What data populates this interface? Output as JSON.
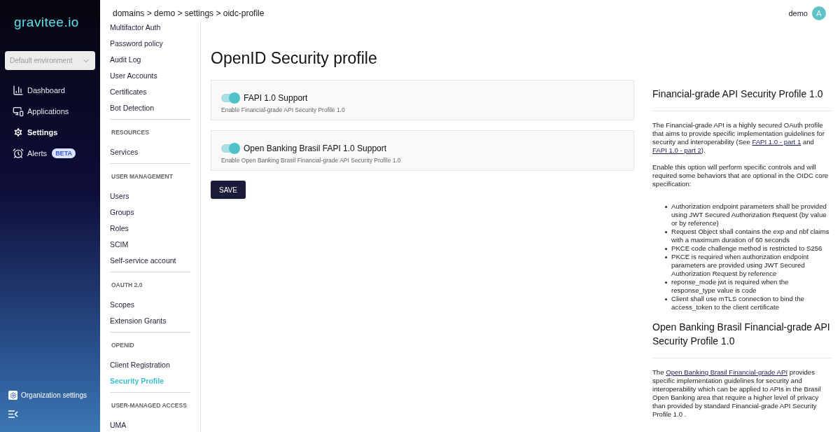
{
  "logo": {
    "text": "gravitee",
    "suffix": ".io"
  },
  "environment": {
    "value": "Default environment"
  },
  "nav": [
    {
      "kind": "chart",
      "label": "Dashboard",
      "selected": false
    },
    {
      "kind": "devices",
      "label": "Applications",
      "selected": false
    },
    {
      "kind": "gear",
      "label": "Settings",
      "selected": true
    },
    {
      "kind": "alarm",
      "label": "Alerts",
      "selected": false,
      "badge": "BETA"
    }
  ],
  "organization_settings": {
    "label": "Organization settings"
  },
  "breadcrumb": "domains > demo > settings > oidc-profile",
  "user": {
    "name": "demo",
    "initial": "A"
  },
  "settings_menu": [
    {
      "kind": "item",
      "label": "Multifactor Auth",
      "selected": false
    },
    {
      "kind": "item",
      "label": "Password policy",
      "selected": false
    },
    {
      "kind": "item",
      "label": "Audit Log",
      "selected": false
    },
    {
      "kind": "item",
      "label": "User Accounts",
      "selected": false
    },
    {
      "kind": "item",
      "label": "Certificates",
      "selected": false
    },
    {
      "kind": "item",
      "label": "Bot Detection",
      "selected": false
    },
    {
      "kind": "section",
      "label": "RESOURCES"
    },
    {
      "kind": "item",
      "label": "Services",
      "selected": false
    },
    {
      "kind": "section",
      "label": "USER MANAGEMENT"
    },
    {
      "kind": "item",
      "label": "Users",
      "selected": false
    },
    {
      "kind": "item",
      "label": "Groups",
      "selected": false
    },
    {
      "kind": "item",
      "label": "Roles",
      "selected": false
    },
    {
      "kind": "item",
      "label": "SCIM",
      "selected": false
    },
    {
      "kind": "item",
      "label": "Self-service account",
      "selected": false
    },
    {
      "kind": "section",
      "label": "OAUTH 2.0"
    },
    {
      "kind": "item",
      "label": "Scopes",
      "selected": false
    },
    {
      "kind": "item",
      "label": "Extension Grants",
      "selected": false
    },
    {
      "kind": "section",
      "label": "OPENID"
    },
    {
      "kind": "item",
      "label": "Client Registration",
      "selected": false
    },
    {
      "kind": "item",
      "label": "Security Profile",
      "selected": true
    },
    {
      "kind": "section",
      "label": "USER-MANAGED ACCESS"
    },
    {
      "kind": "item",
      "label": "UMA",
      "selected": false
    }
  ],
  "page_title": "OpenID Security profile",
  "options": [
    {
      "label": "FAPI 1.0 Support",
      "description": "Enable Financial-grade API Security Profile 1.0",
      "on": true
    },
    {
      "label": "Open Banking Brasil FAPI 1.0 Support",
      "description": "Enable Open Banking Brasil Financial-grade API Security Profile 1.0",
      "on": true
    }
  ],
  "save_button": "SAVE",
  "help": [
    {
      "kind": "heading",
      "text": "Financial-grade API Security Profile 1.0"
    },
    {
      "kind": "paragraph",
      "parts": [
        {
          "text": "The Financial-grade API is a highly secured OAuth profile that aims to provide specific implementation guidelines for security and interoperability (See ",
          "link": false
        },
        {
          "text": "FAPI 1.0 - part 1",
          "link": true
        },
        {
          "text": " and ",
          "link": false
        },
        {
          "text": "FAPI 1.0 - part 2",
          "link": true
        },
        {
          "text": ").",
          "link": false
        }
      ]
    },
    {
      "kind": "paragraph",
      "parts": [
        {
          "text": "Enable this option will perform specific controls and will required some behaviors that are optional in the OIDC core specification:",
          "link": false
        }
      ]
    },
    {
      "kind": "list",
      "items": [
        "Authorization endpoint parameters shall be provided using JWT Secured Authorization Request (by value or by reference)",
        "Request Object shall contains the exp and nbf claims with a maximum duration of 60 seconds",
        "PKCE code challenge method is restricted to S256",
        "PKCE is required when authorization endpoint parameters are provided using JWT Secured Authorization Request by reference",
        "reponse_mode jwt is required when the response_type value is code",
        "Client shall use mTLS connection to bind the access_token to the client certificate"
      ]
    },
    {
      "kind": "heading",
      "text": "Open Banking Brasil Financial-grade API Security Profile 1.0"
    },
    {
      "kind": "paragraph",
      "parts": [
        {
          "text": "The ",
          "link": false
        },
        {
          "text": "Open Banking Brasil Financial-grade API",
          "link": true
        },
        {
          "text": " provides specific implementation guidelines for security and interoperability which can be applied to APIs in the Brasil Open Banking area that require a higher level of privacy than provided by standard Financial-grade API Security Profile 1.0 .",
          "link": false
        }
      ]
    }
  ]
}
